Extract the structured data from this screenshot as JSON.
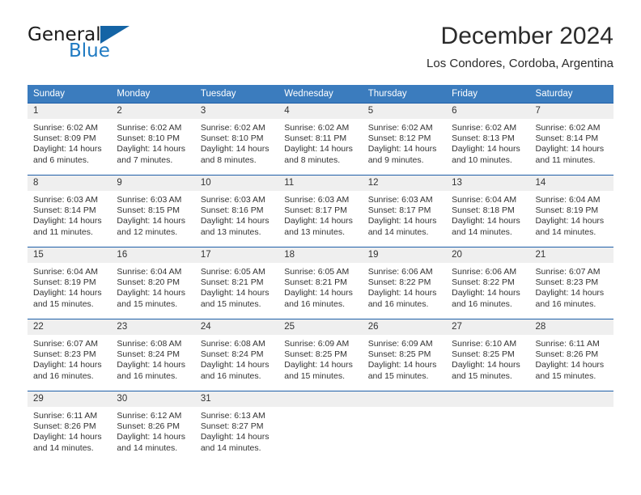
{
  "logo": {
    "word_one": "General",
    "word_two": "Blue",
    "triangle_icon": "triangle-icon",
    "colors": {
      "dark": "#1a1a1a",
      "blue": "#1f7ac2",
      "triangle": "#1464a5"
    }
  },
  "header": {
    "title": "December 2024",
    "subtitle": "Los Condores, Cordoba, Argentina"
  },
  "theme": {
    "header_blue": "#3b7cbe",
    "week_rule_blue": "#1f5fa8",
    "daynum_bg": "#efefef",
    "text": "#333333"
  },
  "calendar": {
    "weekday_headers": [
      "Sunday",
      "Monday",
      "Tuesday",
      "Wednesday",
      "Thursday",
      "Friday",
      "Saturday"
    ],
    "weeks": [
      [
        {
          "day": "1",
          "sunrise": "Sunrise: 6:02 AM",
          "sunset": "Sunset: 8:09 PM",
          "daylight_line1": "Daylight: 14 hours",
          "daylight_line2": "and 6 minutes."
        },
        {
          "day": "2",
          "sunrise": "Sunrise: 6:02 AM",
          "sunset": "Sunset: 8:10 PM",
          "daylight_line1": "Daylight: 14 hours",
          "daylight_line2": "and 7 minutes."
        },
        {
          "day": "3",
          "sunrise": "Sunrise: 6:02 AM",
          "sunset": "Sunset: 8:10 PM",
          "daylight_line1": "Daylight: 14 hours",
          "daylight_line2": "and 8 minutes."
        },
        {
          "day": "4",
          "sunrise": "Sunrise: 6:02 AM",
          "sunset": "Sunset: 8:11 PM",
          "daylight_line1": "Daylight: 14 hours",
          "daylight_line2": "and 8 minutes."
        },
        {
          "day": "5",
          "sunrise": "Sunrise: 6:02 AM",
          "sunset": "Sunset: 8:12 PM",
          "daylight_line1": "Daylight: 14 hours",
          "daylight_line2": "and 9 minutes."
        },
        {
          "day": "6",
          "sunrise": "Sunrise: 6:02 AM",
          "sunset": "Sunset: 8:13 PM",
          "daylight_line1": "Daylight: 14 hours",
          "daylight_line2": "and 10 minutes."
        },
        {
          "day": "7",
          "sunrise": "Sunrise: 6:02 AM",
          "sunset": "Sunset: 8:14 PM",
          "daylight_line1": "Daylight: 14 hours",
          "daylight_line2": "and 11 minutes."
        }
      ],
      [
        {
          "day": "8",
          "sunrise": "Sunrise: 6:03 AM",
          "sunset": "Sunset: 8:14 PM",
          "daylight_line1": "Daylight: 14 hours",
          "daylight_line2": "and 11 minutes."
        },
        {
          "day": "9",
          "sunrise": "Sunrise: 6:03 AM",
          "sunset": "Sunset: 8:15 PM",
          "daylight_line1": "Daylight: 14 hours",
          "daylight_line2": "and 12 minutes."
        },
        {
          "day": "10",
          "sunrise": "Sunrise: 6:03 AM",
          "sunset": "Sunset: 8:16 PM",
          "daylight_line1": "Daylight: 14 hours",
          "daylight_line2": "and 13 minutes."
        },
        {
          "day": "11",
          "sunrise": "Sunrise: 6:03 AM",
          "sunset": "Sunset: 8:17 PM",
          "daylight_line1": "Daylight: 14 hours",
          "daylight_line2": "and 13 minutes."
        },
        {
          "day": "12",
          "sunrise": "Sunrise: 6:03 AM",
          "sunset": "Sunset: 8:17 PM",
          "daylight_line1": "Daylight: 14 hours",
          "daylight_line2": "and 14 minutes."
        },
        {
          "day": "13",
          "sunrise": "Sunrise: 6:04 AM",
          "sunset": "Sunset: 8:18 PM",
          "daylight_line1": "Daylight: 14 hours",
          "daylight_line2": "and 14 minutes."
        },
        {
          "day": "14",
          "sunrise": "Sunrise: 6:04 AM",
          "sunset": "Sunset: 8:19 PM",
          "daylight_line1": "Daylight: 14 hours",
          "daylight_line2": "and 14 minutes."
        }
      ],
      [
        {
          "day": "15",
          "sunrise": "Sunrise: 6:04 AM",
          "sunset": "Sunset: 8:19 PM",
          "daylight_line1": "Daylight: 14 hours",
          "daylight_line2": "and 15 minutes."
        },
        {
          "day": "16",
          "sunrise": "Sunrise: 6:04 AM",
          "sunset": "Sunset: 8:20 PM",
          "daylight_line1": "Daylight: 14 hours",
          "daylight_line2": "and 15 minutes."
        },
        {
          "day": "17",
          "sunrise": "Sunrise: 6:05 AM",
          "sunset": "Sunset: 8:21 PM",
          "daylight_line1": "Daylight: 14 hours",
          "daylight_line2": "and 15 minutes."
        },
        {
          "day": "18",
          "sunrise": "Sunrise: 6:05 AM",
          "sunset": "Sunset: 8:21 PM",
          "daylight_line1": "Daylight: 14 hours",
          "daylight_line2": "and 16 minutes."
        },
        {
          "day": "19",
          "sunrise": "Sunrise: 6:06 AM",
          "sunset": "Sunset: 8:22 PM",
          "daylight_line1": "Daylight: 14 hours",
          "daylight_line2": "and 16 minutes."
        },
        {
          "day": "20",
          "sunrise": "Sunrise: 6:06 AM",
          "sunset": "Sunset: 8:22 PM",
          "daylight_line1": "Daylight: 14 hours",
          "daylight_line2": "and 16 minutes."
        },
        {
          "day": "21",
          "sunrise": "Sunrise: 6:07 AM",
          "sunset": "Sunset: 8:23 PM",
          "daylight_line1": "Daylight: 14 hours",
          "daylight_line2": "and 16 minutes."
        }
      ],
      [
        {
          "day": "22",
          "sunrise": "Sunrise: 6:07 AM",
          "sunset": "Sunset: 8:23 PM",
          "daylight_line1": "Daylight: 14 hours",
          "daylight_line2": "and 16 minutes."
        },
        {
          "day": "23",
          "sunrise": "Sunrise: 6:08 AM",
          "sunset": "Sunset: 8:24 PM",
          "daylight_line1": "Daylight: 14 hours",
          "daylight_line2": "and 16 minutes."
        },
        {
          "day": "24",
          "sunrise": "Sunrise: 6:08 AM",
          "sunset": "Sunset: 8:24 PM",
          "daylight_line1": "Daylight: 14 hours",
          "daylight_line2": "and 16 minutes."
        },
        {
          "day": "25",
          "sunrise": "Sunrise: 6:09 AM",
          "sunset": "Sunset: 8:25 PM",
          "daylight_line1": "Daylight: 14 hours",
          "daylight_line2": "and 15 minutes."
        },
        {
          "day": "26",
          "sunrise": "Sunrise: 6:09 AM",
          "sunset": "Sunset: 8:25 PM",
          "daylight_line1": "Daylight: 14 hours",
          "daylight_line2": "and 15 minutes."
        },
        {
          "day": "27",
          "sunrise": "Sunrise: 6:10 AM",
          "sunset": "Sunset: 8:25 PM",
          "daylight_line1": "Daylight: 14 hours",
          "daylight_line2": "and 15 minutes."
        },
        {
          "day": "28",
          "sunrise": "Sunrise: 6:11 AM",
          "sunset": "Sunset: 8:26 PM",
          "daylight_line1": "Daylight: 14 hours",
          "daylight_line2": "and 15 minutes."
        }
      ],
      [
        {
          "day": "29",
          "sunrise": "Sunrise: 6:11 AM",
          "sunset": "Sunset: 8:26 PM",
          "daylight_line1": "Daylight: 14 hours",
          "daylight_line2": "and 14 minutes."
        },
        {
          "day": "30",
          "sunrise": "Sunrise: 6:12 AM",
          "sunset": "Sunset: 8:26 PM",
          "daylight_line1": "Daylight: 14 hours",
          "daylight_line2": "and 14 minutes."
        },
        {
          "day": "31",
          "sunrise": "Sunrise: 6:13 AM",
          "sunset": "Sunset: 8:27 PM",
          "daylight_line1": "Daylight: 14 hours",
          "daylight_line2": "and 14 minutes."
        },
        {
          "day": "",
          "sunrise": "",
          "sunset": "",
          "daylight_line1": "",
          "daylight_line2": ""
        },
        {
          "day": "",
          "sunrise": "",
          "sunset": "",
          "daylight_line1": "",
          "daylight_line2": ""
        },
        {
          "day": "",
          "sunrise": "",
          "sunset": "",
          "daylight_line1": "",
          "daylight_line2": ""
        },
        {
          "day": "",
          "sunrise": "",
          "sunset": "",
          "daylight_line1": "",
          "daylight_line2": ""
        }
      ]
    ]
  }
}
